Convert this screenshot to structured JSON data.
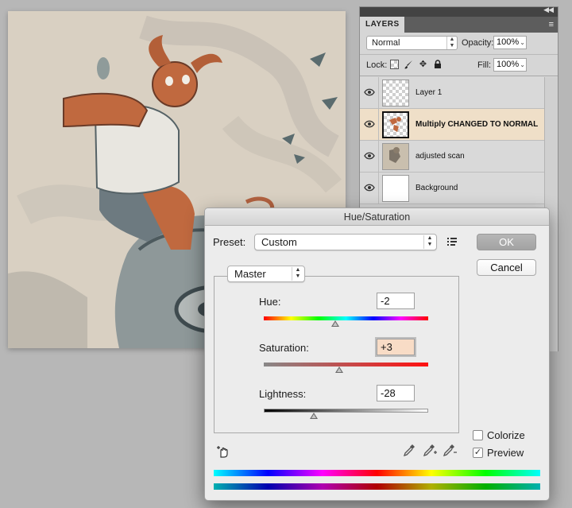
{
  "layers_panel": {
    "tab_label": "LAYERS",
    "collapse_glyph": "◀◀",
    "menu_glyph": "≡",
    "blend_mode": "Normal",
    "opacity_label": "Opacity:",
    "opacity_value": "100%",
    "lock_label": "Lock:",
    "fill_label": "Fill:",
    "fill_value": "100%",
    "layers": [
      {
        "name": "Layer 1",
        "visible": true,
        "selected": false,
        "thumb": "transparent"
      },
      {
        "name": "Multiply CHANGED TO NORMAL",
        "visible": true,
        "selected": true,
        "thumb": "sketch-orange"
      },
      {
        "name": "adjusted scan",
        "visible": true,
        "selected": false,
        "thumb": "scan"
      },
      {
        "name": "Background",
        "visible": true,
        "selected": false,
        "thumb": "white"
      }
    ]
  },
  "dialog": {
    "title": "Hue/Saturation",
    "preset_label": "Preset:",
    "preset_value": "Custom",
    "ok_label": "OK",
    "cancel_label": "Cancel",
    "channel": "Master",
    "hue_label": "Hue:",
    "hue_value": "-2",
    "hue_range": [
      -180,
      180
    ],
    "saturation_label": "Saturation:",
    "saturation_value": "+3",
    "saturation_range": [
      -100,
      100
    ],
    "lightness_label": "Lightness:",
    "lightness_value": "-28",
    "lightness_range": [
      -100,
      100
    ],
    "colorize_label": "Colorize",
    "colorize_checked": false,
    "preview_label": "Preview",
    "preview_checked": true,
    "check_glyph": "✓"
  },
  "colors": {
    "workspace": "#b7b7b7",
    "selected_layer": "#efdfc8",
    "canvas_paper": "#d8cfc1",
    "figure_orange": "#c0693f"
  }
}
